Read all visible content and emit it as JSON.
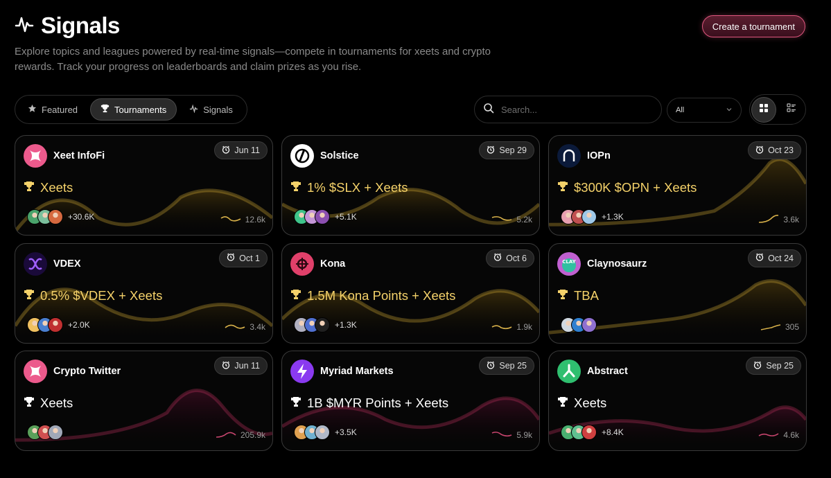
{
  "header": {
    "title": "Signals",
    "subtitle": "Explore topics and leagues powered by real-time signals—compete in tournaments for xeets and crypto rewards. Track your progress on leaderboards and claim prizes as you rise.",
    "create_button": "Create a tournament"
  },
  "tabs": [
    {
      "label": "Featured",
      "icon": "star-icon",
      "active": false
    },
    {
      "label": "Tournaments",
      "icon": "trophy-icon",
      "active": true
    },
    {
      "label": "Signals",
      "icon": "signal-icon",
      "active": false
    }
  ],
  "search": {
    "placeholder": "Search..."
  },
  "filter": {
    "selected": "All"
  },
  "colors": {
    "gold": "#f5d26a",
    "accent_pink": "#e0577f",
    "gold_glow": "#8a6a10",
    "pink_glow": "#7a1a3a"
  },
  "cards": [
    {
      "name": "Xeet InfoFi",
      "date": "Jun 11",
      "prize": "Xeets",
      "participants": "+30.6K",
      "metric": "12.6k",
      "logo": "xeet",
      "theme": "gold",
      "avatar_colors": [
        "#4aa36b",
        "#7bbf9c",
        "#d6693f"
      ]
    },
    {
      "name": "Solstice",
      "date": "Sep 29",
      "prize": "1% $SLX + Xeets",
      "participants": "+5.1K",
      "metric": "5.2k",
      "logo": "solstice",
      "theme": "gold",
      "avatar_colors": [
        "#3fc48b",
        "#c596d8",
        "#8c4fb0"
      ]
    },
    {
      "name": "IOPn",
      "date": "Oct 23",
      "prize": "$300K $OPN + Xeets",
      "participants": "+1.3K",
      "metric": "3.6k",
      "logo": "iopn",
      "theme": "gold",
      "avatar_colors": [
        "#e8a0b0",
        "#c05050",
        "#9ec8e8"
      ]
    },
    {
      "name": "VDEX",
      "date": "Oct 1",
      "prize": "0.5% $VDEX + Xeets",
      "participants": "+2.0K",
      "metric": "3.4k",
      "logo": "vdex",
      "theme": "gold",
      "avatar_colors": [
        "#f0c060",
        "#4a7fd0",
        "#c03030"
      ]
    },
    {
      "name": "Kona",
      "date": "Oct 6",
      "prize": "1.5M Kona Points + Xeets",
      "participants": "+1.3K",
      "metric": "1.9k",
      "logo": "kona",
      "theme": "gold",
      "avatar_colors": [
        "#b0b0c0",
        "#5070d0",
        "#202020"
      ]
    },
    {
      "name": "Claynosaurz",
      "date": "Oct 24",
      "prize": "TBA",
      "participants": "",
      "metric": "305",
      "logo": "clay",
      "theme": "gold",
      "avatar_colors": [
        "#d0d8e0",
        "#3080d0",
        "#9070d0"
      ]
    },
    {
      "name": "Crypto Twitter",
      "date": "Jun 11",
      "prize": "Xeets",
      "participants": "",
      "metric": "205.9k",
      "logo": "xeet",
      "theme": "pink",
      "avatar_colors": [
        "#5aa05a",
        "#d05050",
        "#a0a8b8"
      ]
    },
    {
      "name": "Myriad Markets",
      "date": "Sep 25",
      "prize": "1B $MYR Points + Xeets",
      "participants": "+3.5K",
      "metric": "5.9k",
      "logo": "myriad",
      "theme": "pink",
      "avatar_colors": [
        "#e0a050",
        "#70b0d0",
        "#b0b8c8"
      ]
    },
    {
      "name": "Abstract",
      "date": "Sep 25",
      "prize": "Xeets",
      "participants": "+8.4K",
      "metric": "4.6k",
      "logo": "abstract",
      "theme": "pink",
      "avatar_colors": [
        "#4ab070",
        "#60c090",
        "#d04040"
      ]
    }
  ]
}
